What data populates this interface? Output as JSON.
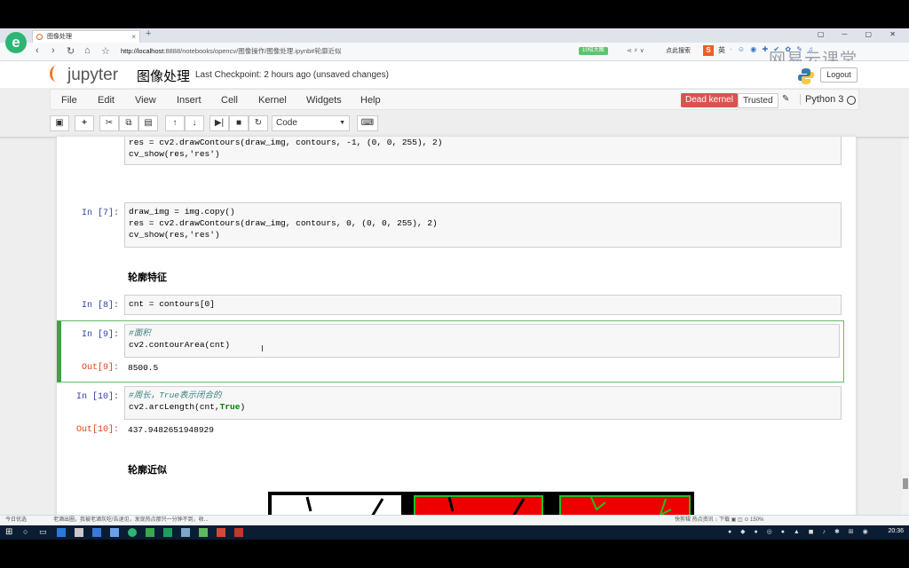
{
  "browser": {
    "tab_title": "图像处理",
    "new_tab": "+",
    "window_controls": "▢ ─ ▢ ✕",
    "url_host": "http://localhost",
    "url_rest": ":8888/notebooks/opencv/图像操作/图像处理.ipynb#轮廓近似",
    "badge": "10倍大图",
    "search_label": "点此搜索",
    "ime_label": "英",
    "watermark": "网易云课堂"
  },
  "jupyter": {
    "logo": "jupyter",
    "notebook_title": "图像处理",
    "checkpoint": "Last Checkpoint: 2 hours ago (unsaved changes)",
    "logout": "Logout",
    "menu": [
      "File",
      "Edit",
      "View",
      "Insert",
      "Cell",
      "Kernel",
      "Widgets",
      "Help"
    ],
    "dead_kernel": "Dead kernel",
    "trusted": "Trusted",
    "kernel_name": "Python 3",
    "cell_type": "Code"
  },
  "cells": {
    "c6": {
      "line1": "res = cv2.drawContours(draw_img, contours, -1, (0, 0, 255), 2)",
      "line2": "cv_show(res,'res')"
    },
    "c7": {
      "prompt": "In [7]:",
      "line1": "draw_img = img.copy()",
      "line2": "res = cv2.drawContours(draw_img, contours, 0, (0, 0, 255), 2)",
      "line3": "cv_show(res,'res')"
    },
    "md1": "轮廓特征",
    "c8": {
      "prompt": "In [8]:",
      "line1": "cnt = contours[0]"
    },
    "c9": {
      "prompt": "In [9]:",
      "comment": "#面积",
      "line2": "cv2.contourArea(cnt)",
      "out_prompt": "Out[9]:",
      "out": "8500.5"
    },
    "c10": {
      "prompt": "In [10]:",
      "comment": "#周长，True表示闭合的",
      "line2_pre": "cv2.arcLength(cnt,",
      "line2_kw": "True",
      "line2_post": ")",
      "out_prompt": "Out[10]:",
      "out": "437.9482651948929"
    },
    "md2": "轮廓近似"
  },
  "statusbar": {
    "left": "今日优选",
    "news": "老酒出圈，我被老酒灰吃!告退见，发现热点那只一分钟不到，收...",
    "right": "快剪辑    热点资讯    ↓ 下载    ▣  ◫  ⊙  150%"
  },
  "taskbar": {
    "time": "20:36"
  }
}
